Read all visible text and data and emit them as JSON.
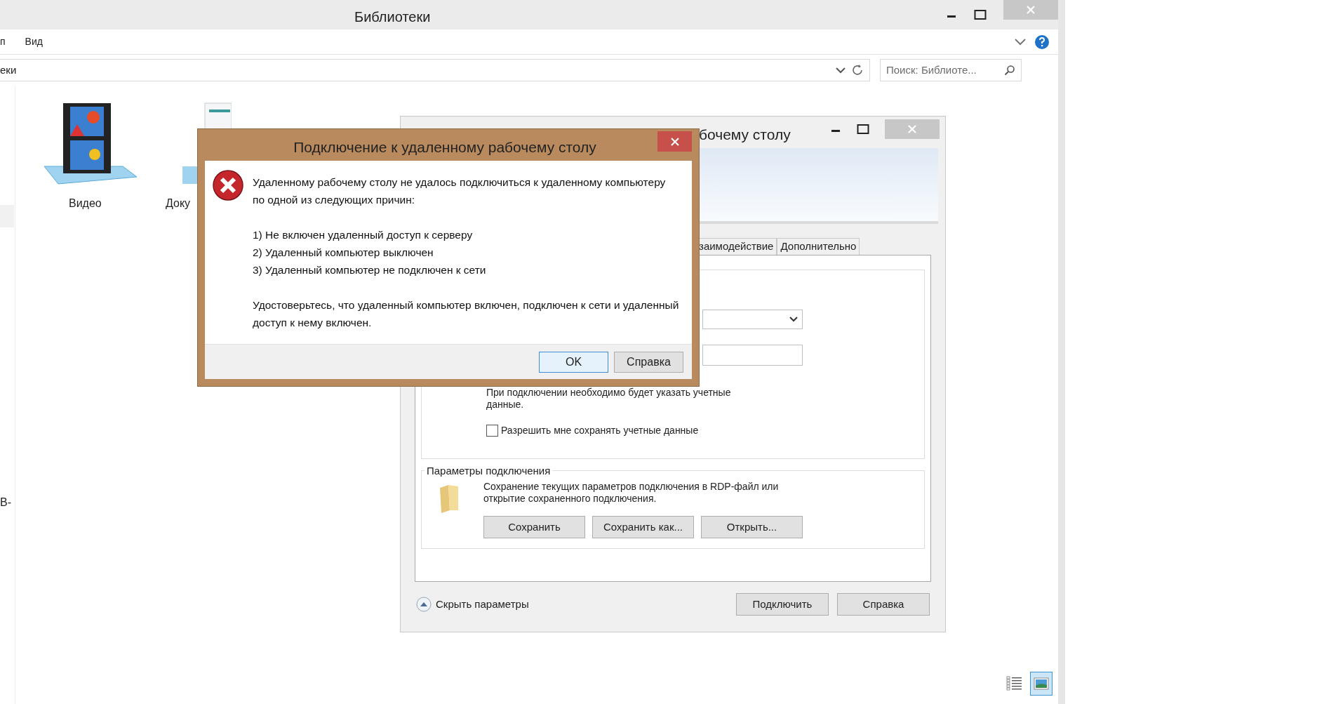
{
  "explorer": {
    "title": "Библиотеки",
    "menu": [
      "п",
      "Вид"
    ],
    "address": "еки",
    "search": {
      "placeholder": "Поиск: Библиоте..."
    },
    "items": [
      {
        "kind": "video",
        "label": "Видео"
      },
      {
        "kind": "document",
        "label": "Доку"
      }
    ],
    "cut_label": "В-",
    "view_buttons": [
      {
        "kind": "details",
        "selected": false
      },
      {
        "kind": "tiles",
        "selected": true
      }
    ]
  },
  "rdp_window": {
    "title": "бочему столу",
    "tabs": [
      {
        "label": "заимодействие",
        "selected": false
      },
      {
        "label": "Дополнительно",
        "selected": false
      }
    ],
    "credentials_note": "При подключении необходимо будет указать учетные данные.",
    "save_credentials": {
      "label": "Разрешить мне сохранять учетные данные",
      "checked": false
    },
    "connection_group": {
      "title": "Параметры подключения",
      "description": "Сохранение текущих параметров подключения в RDP-файл или открытие сохраненного подключения.",
      "buttons": [
        "Сохранить",
        "Сохранить как...",
        "Открыть..."
      ]
    },
    "hide_options": "Скрыть параметры",
    "buttons": [
      {
        "label": "Подключить"
      },
      {
        "label": "Справка"
      }
    ]
  },
  "error_dialog": {
    "title": "Подключение к удаленному рабочему столу",
    "message": "Удаленному рабочему столу не удалось подключиться к удаленному компьютеру по одной из следующих причин:",
    "reasons": [
      "1) Не включен удаленный доступ к серверу",
      "2) Удаленный компьютер выключен",
      "3) Удаленный компьютер не подключен к сети"
    ],
    "advice": "Удостоверьтесь, что удаленный компьютер включен, подключен к сети и удаленный доступ к нему включен.",
    "buttons": [
      {
        "label": "OK",
        "default": true
      },
      {
        "label": "Справка",
        "default": false
      }
    ]
  }
}
